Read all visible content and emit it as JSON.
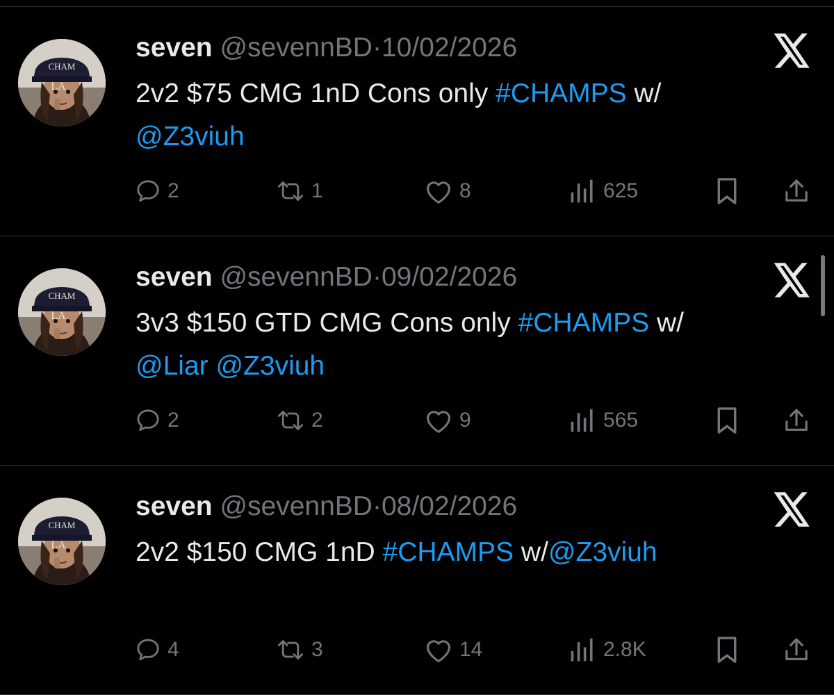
{
  "tweets": [
    {
      "display_name": "seven",
      "handle": "@sevennBD",
      "separator": "·",
      "date": "10/02/2026",
      "segments": [
        {
          "text": "2v2 $75 CMG 1nD Cons only ",
          "link": false
        },
        {
          "text": "#CHAMPS",
          "link": true
        },
        {
          "text": " w/",
          "link": false
        },
        {
          "text": "\n",
          "link": false
        },
        {
          "text": "@Z3viuh",
          "link": true
        }
      ],
      "replies": "2",
      "reposts": "1",
      "likes": "8",
      "views": "625"
    },
    {
      "display_name": "seven",
      "handle": "@sevennBD",
      "separator": "·",
      "date": "09/02/2026",
      "segments": [
        {
          "text": "3v3 $150 GTD CMG Cons only ",
          "link": false
        },
        {
          "text": "#CHAMPS",
          "link": true
        },
        {
          "text": " w/",
          "link": false
        },
        {
          "text": "\n",
          "link": false
        },
        {
          "text": "@Liar",
          "link": true
        },
        {
          "text": " ",
          "link": false
        },
        {
          "text": "@Z3viuh",
          "link": true
        }
      ],
      "replies": "2",
      "reposts": "2",
      "likes": "9",
      "views": "565"
    },
    {
      "display_name": "seven",
      "handle": "@sevennBD",
      "separator": "·",
      "date": "08/02/2026",
      "segments": [
        {
          "text": "2v2 $150 CMG 1nD ",
          "link": false
        },
        {
          "text": "#CHAMPS",
          "link": true
        },
        {
          "text": " w/",
          "link": false
        },
        {
          "text": "@Z3viuh",
          "link": true
        }
      ],
      "replies": "4",
      "reposts": "3",
      "likes": "14",
      "views": "2.8K"
    }
  ],
  "icons": {
    "platform": "x-logo-icon",
    "reply": "reply-bubble-icon",
    "repost": "repost-arrows-icon",
    "like": "heart-icon",
    "views": "views-bar-chart-icon",
    "bookmark": "bookmark-icon",
    "share": "share-upload-icon"
  },
  "colors": {
    "background": "#000000",
    "primary_text": "#e7e9ea",
    "secondary_text": "#71767b",
    "link": "#1d9bf0",
    "divider": "#2f3336"
  }
}
